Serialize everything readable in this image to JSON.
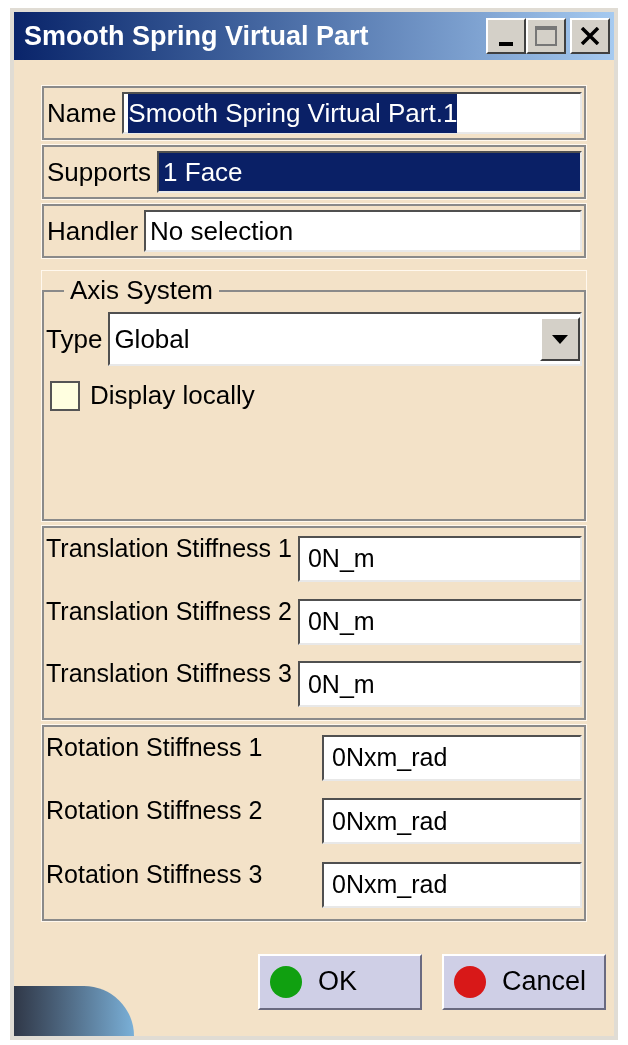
{
  "window": {
    "title": "Smooth Spring Virtual Part"
  },
  "fields": [
    {
      "kind": "text",
      "label": "Name",
      "value": "Smooth Spring Virtual Part.1",
      "selected": true
    },
    {
      "kind": "selection",
      "label": "Supports",
      "value": "1 Face",
      "selected": true
    },
    {
      "kind": "selection",
      "label": "Handler",
      "value": "No selection",
      "selected": false
    }
  ],
  "axis_system": {
    "title": "Axis System",
    "type_label": "Type",
    "type_value": "Global",
    "display_locally": {
      "label": "Display locally",
      "checked": false
    }
  },
  "translation": [
    {
      "label": "Translation Stiffness 1",
      "value": "0N_m"
    },
    {
      "label": "Translation Stiffness 2",
      "value": "0N_m"
    },
    {
      "label": "Translation Stiffness 3",
      "value": "0N_m"
    }
  ],
  "rotation": [
    {
      "label": "Rotation Stiffness 1",
      "value": "0Nxm_rad"
    },
    {
      "label": "Rotation Stiffness 2",
      "value": "0Nxm_rad"
    },
    {
      "label": "Rotation Stiffness 3",
      "value": "0Nxm_rad"
    }
  ],
  "buttons": [
    {
      "label": "OK",
      "color": "#10a010"
    },
    {
      "label": "Cancel",
      "color": "#d81818"
    }
  ]
}
